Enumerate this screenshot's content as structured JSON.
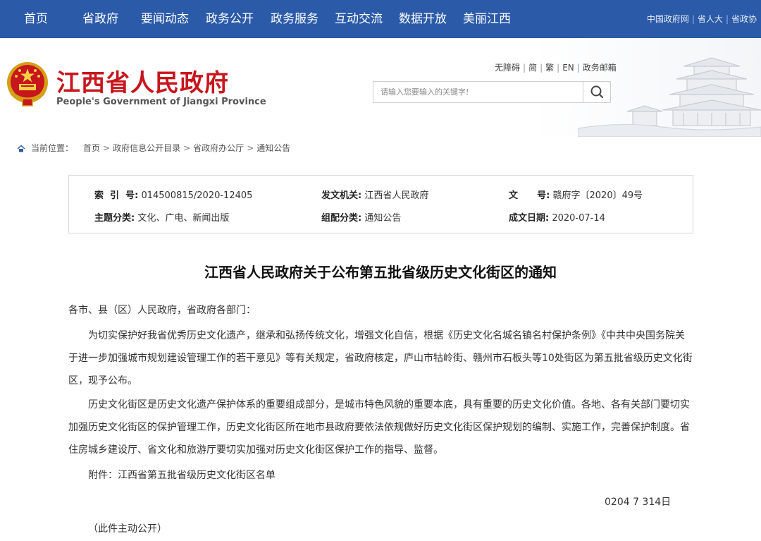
{
  "nav": {
    "items": [
      "首页",
      "省政府",
      "要闻动态",
      "政务公开",
      "政务服务",
      "互动交流",
      "数据开放",
      "美丽江西"
    ],
    "top_links": [
      "中国政府网",
      "省人大",
      "省政协"
    ]
  },
  "header": {
    "title": "江西省人民政府",
    "subtitle": "People's Government of Jiangxi Province",
    "tools": [
      "无障碍",
      "简",
      "繁",
      "EN",
      "政务邮箱"
    ],
    "search_placeholder": "请输入您要输入的关键字!"
  },
  "breadcrumb": {
    "label": "当前位置：",
    "items": [
      "首页",
      "政府信息公开目录",
      "省政府办公厅",
      "通知公告"
    ]
  },
  "meta": {
    "index_label": "索  引  号:",
    "index_value": "014500815/2020-12405",
    "issuer_label": "发文机关:",
    "issuer_value": "江西省人民政府",
    "docno_label": "文      号:",
    "docno_value": "赣府字〔2020〕49号",
    "topic_label": "主题分类:",
    "topic_value": "文化、广电、新闻出版",
    "group_label": "组配分类:",
    "group_value": "通知公告",
    "date_label": "成文日期:",
    "date_value": "2020-07-14"
  },
  "article": {
    "title": "江西省人民政府关于公布第五批省级历史文化街区的通知",
    "salutation": "各市、县（区）人民政府，省政府各部门：",
    "para1": "为切实保护好我省优秀历史文化遗产，继承和弘扬传统文化，增强文化自信，根据《历史文化名城名镇名村保护条例》《中共中央国务院关于进一步加强城市规划建设管理工作的若干意见》等有关规定，省政府核定，庐山市牯岭街、赣州市石板头等10处街区为第五批省级历史文化街区，现予公布。",
    "para2": "历史文化街区是历史文化遗产保护体系的重要组成部分，是城市特色风貌的重要本底，具有重要的历史文化价值。各地、各有关部门要切实加强历史文化街区的保护管理工作，历史文化街区所在地市县政府要依法依规做好历史文化街区保护规划的编制、实施工作，完善保护制度。省住房城乡建设厅、省文化和旅游厅要切实加强对历史文化街区保护工作的指导、监督。",
    "attachment": "附件：江西省第五批省级历史文化街区名单",
    "date_fragment": "0204 7 314日",
    "footer_note": "（此件主动公开）"
  },
  "colors": {
    "nav_bg": "#2b5aa8",
    "title_red": "#c8161d"
  }
}
